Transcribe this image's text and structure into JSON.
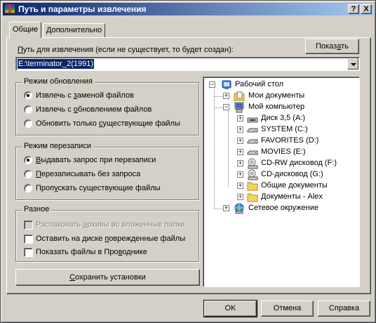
{
  "window": {
    "title": "Путь и параметры извлечения",
    "help_btn": "?",
    "close_btn": "X"
  },
  "tabs": [
    {
      "label": "Общие",
      "active": true
    },
    {
      "label": "Дополнительно",
      "active": false
    }
  ],
  "path": {
    "label_pre": "",
    "label_u": "П",
    "label_post": "уть для извлечения (если не существует, то будет создан):",
    "value": "E:\\terminator_2(1991)",
    "show_btn_pre": "Показ",
    "show_btn_u": "а",
    "show_btn_post": "ть"
  },
  "update_mode": {
    "title": "Режим обновления",
    "options": [
      {
        "pre": "Извлечь с ",
        "u": "з",
        "post": "аменой файлов",
        "selected": true
      },
      {
        "pre": "Извлечь с ",
        "u": "о",
        "post": "бновлением файлов",
        "selected": false
      },
      {
        "pre": "Обновить только ",
        "u": "с",
        "post": "уществующие файлы",
        "selected": false
      }
    ]
  },
  "overwrite_mode": {
    "title": "Режим перезаписи",
    "options": [
      {
        "pre": "",
        "u": "В",
        "post": "ыдавать запрос при перезаписи",
        "selected": true
      },
      {
        "pre": "",
        "u": "П",
        "post": "ерезаписывать без запроса",
        "selected": false
      },
      {
        "pre": "Проп",
        "u": "у",
        "post": "скать существующие файлы",
        "selected": false
      }
    ]
  },
  "misc": {
    "title": "Разное",
    "options": [
      {
        "pre": "Распаковать ",
        "u": "а",
        "post": "рхивы во вложенные папки",
        "checked": false,
        "disabled": true
      },
      {
        "pre": "Оставить на диске ",
        "u": "п",
        "post": "оврежденные файлы",
        "checked": false,
        "disabled": false
      },
      {
        "pre": "Показать файлы в Про",
        "u": "в",
        "post": "однике",
        "checked": false,
        "disabled": false
      }
    ]
  },
  "save_btn": {
    "pre": "",
    "u": "С",
    "post": "охранить установки"
  },
  "tree": {
    "root": "Рабочий стол",
    "nodes": [
      {
        "label": "Мои документы",
        "icon": "my-documents-icon"
      },
      {
        "label": "Мой компьютер",
        "icon": "my-computer-icon"
      },
      {
        "label": "Диск 3,5 (A:)",
        "icon": "floppy-drive-icon"
      },
      {
        "label": "SYSTEM (C:)",
        "icon": "hard-drive-icon"
      },
      {
        "label": "FAVORITES (D:)",
        "icon": "hard-drive-icon"
      },
      {
        "label": "MOVIES (E:)",
        "icon": "hard-drive-icon"
      },
      {
        "label": "CD-RW дисковод (F:)",
        "icon": "cd-drive-icon"
      },
      {
        "label": "CD-дисковод (G:)",
        "icon": "cd-drive-icon"
      },
      {
        "label": "Общие документы",
        "icon": "folder-icon"
      },
      {
        "label": "Документы - Alex",
        "icon": "folder-icon"
      },
      {
        "label": "Сетевое окружение",
        "icon": "network-icon"
      }
    ]
  },
  "footer": {
    "ok": "OK",
    "cancel": "Отмена",
    "help": "Справка"
  }
}
